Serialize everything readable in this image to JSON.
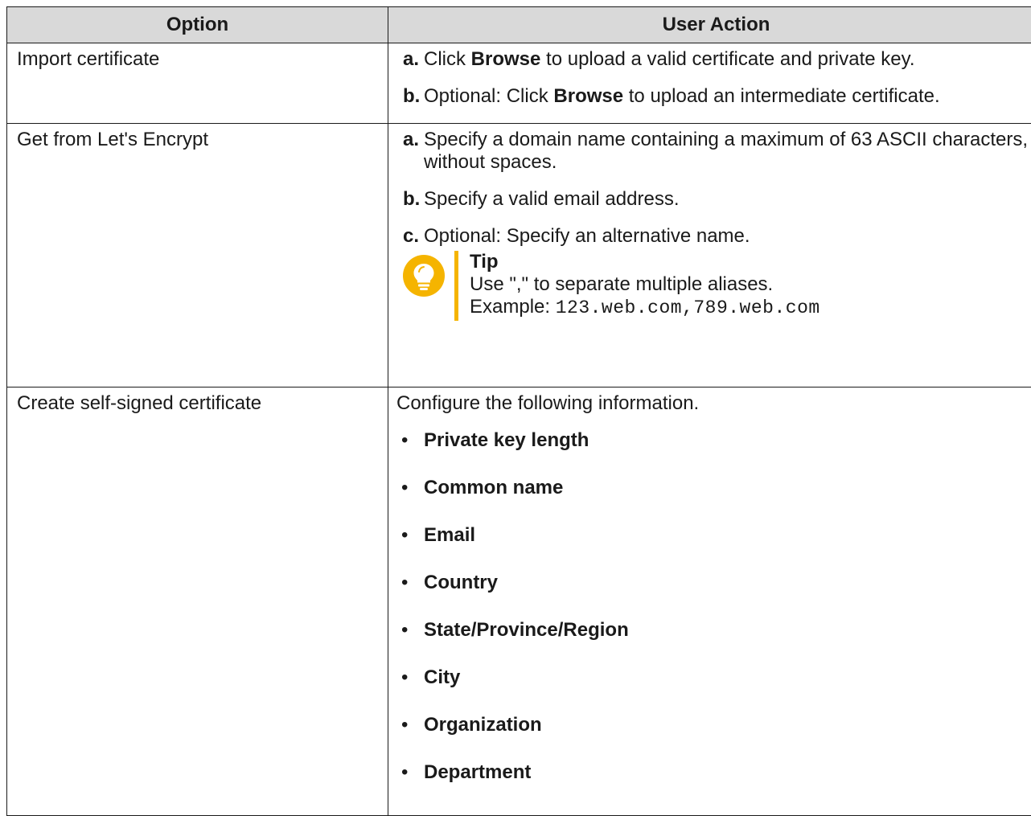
{
  "table": {
    "header": {
      "option": "Option",
      "user_action": "User Action"
    },
    "rows": [
      {
        "option": "Import certificate",
        "steps": [
          {
            "label": "a.",
            "pre": "Click ",
            "bold": "Browse",
            "post": " to upload a valid certificate and private key."
          },
          {
            "label": "b.",
            "pre": "Optional: Click ",
            "bold": "Browse",
            "post": " to upload an intermediate certificate."
          }
        ]
      },
      {
        "option": "Get from Let's Encrypt",
        "steps": [
          {
            "label": "a.",
            "text": "Specify a domain name containing a maximum of 63 ASCII characters, without spaces."
          },
          {
            "label": "b.",
            "text": "Specify a valid email address."
          },
          {
            "label": "c.",
            "text": "Optional: Specify an alternative name."
          }
        ],
        "tip": {
          "icon": "lightbulb-icon",
          "title": "Tip",
          "line1": "Use \",\" to separate multiple aliases.",
          "example_label": "Example",
          "example_sep": ": ",
          "example_code": "123.web.com,789.web.com"
        }
      },
      {
        "option": "Create self-signed certificate",
        "intro": "Configure the following information.",
        "bullet": "•",
        "fields": [
          "Private key length",
          "Common name",
          "Email",
          "Country",
          "State/Province/Region",
          "City",
          "Organization",
          "Department"
        ]
      }
    ]
  },
  "colors": {
    "header_bg": "#d9d9d9",
    "border": "#1a1a1a",
    "tip_accent": "#f5b400"
  }
}
